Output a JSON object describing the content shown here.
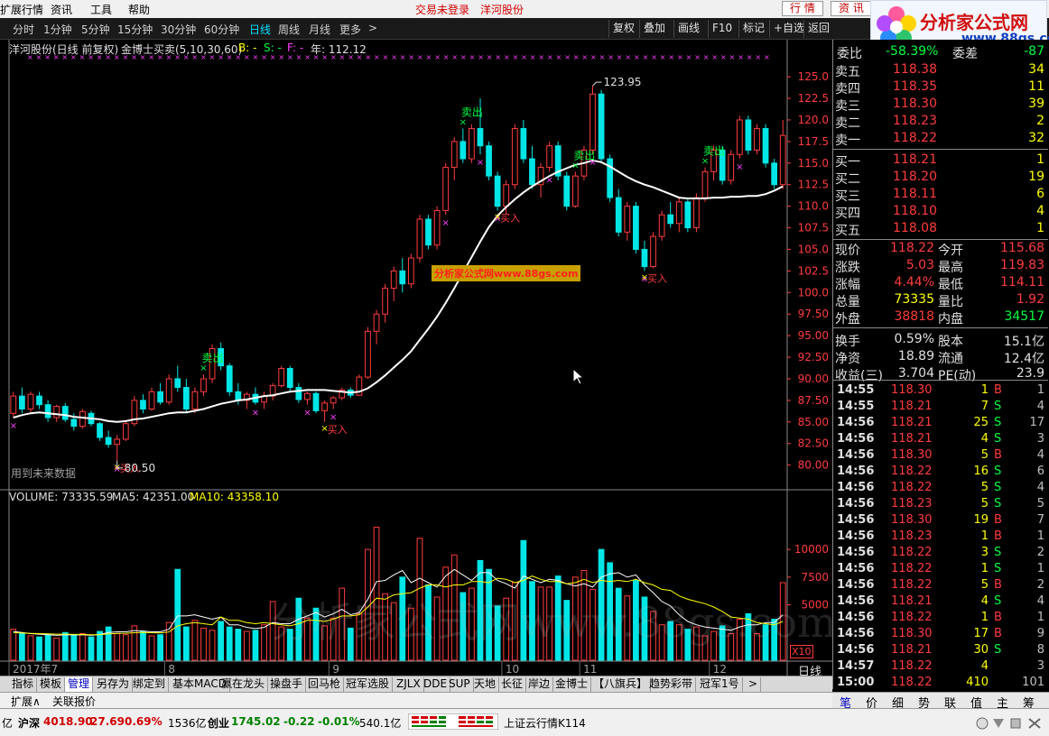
{
  "menubar": {
    "items": [
      "扩展行情",
      "资讯",
      "工具",
      "帮助"
    ],
    "center_status": "交易未登录",
    "center_stock": "洋河股份",
    "btn_quote": "行 情",
    "btn_info": "资 讯"
  },
  "logo": {
    "title": "分析家公式网",
    "url": "www.88gs.com"
  },
  "toolbar": {
    "periods": [
      "分时",
      "1分钟",
      "5分钟",
      "15分钟",
      "30分钟",
      "60分钟",
      "日线",
      "周线",
      "月线",
      "更多"
    ],
    "active_period": "日线",
    "more_arrow": ">",
    "right_buttons": [
      "复权",
      "叠加",
      "画线",
      "F10",
      "标记",
      "+自选",
      "返回"
    ]
  },
  "chart_header": {
    "stock": "洋河股份(日线 前复权)",
    "indicator": "金博士买卖(5,10,30,60)",
    "b_label": "B: -",
    "s_label": "S: -",
    "f_label": "F: -",
    "year_label": "年: 112.12"
  },
  "price_axis": {
    "ticks": [
      "125.0",
      "122.5",
      "120.0",
      "117.5",
      "115.0",
      "112.5",
      "110.0",
      "107.5",
      "105.0",
      "102.5",
      "100.0",
      "97.50",
      "95.00",
      "92.50",
      "90.00",
      "87.50",
      "85.00",
      "82.50",
      "80.00"
    ]
  },
  "annotations": {
    "high_label": "123.95",
    "low_label": "80.50",
    "sell_labels": [
      "卖出",
      "卖出",
      "卖出",
      "卖出"
    ],
    "buy_labels": [
      "买入",
      "买入",
      "买入",
      "买入"
    ],
    "future_note": "用到未来数据",
    "watermark_box": "分析家公式网www.88gs.com",
    "watermark_big": "分析家公式网www.88gs.com"
  },
  "volume_panel": {
    "volume_label": "VOLUME: 73335.59",
    "ma5_label": "MA5: 42351.00",
    "ma10_label": "MA10: 43358.10",
    "ticks": [
      "10000",
      "7500",
      "5000"
    ],
    "unit": "X10"
  },
  "date_axis": {
    "labels": [
      "2017年7",
      "8",
      "9",
      "10",
      "11",
      "12"
    ],
    "period": "日线",
    "controls": [
      "+",
      "-",
      "0"
    ]
  },
  "colors": {
    "up": "#ff3c3c",
    "down": "#00e6e6",
    "ma_line": "#ffffff",
    "sell": "#00ff40",
    "buy": "#ffff00",
    "marker_magenta": "#ff40ff",
    "accent_yellow": "#ffff00"
  },
  "chart_data": {
    "type": "candlestick",
    "title": "洋河股份(日线 前复权)",
    "xlabel": "",
    "ylabel": "",
    "ylim": [
      78.5,
      127
    ],
    "candles": [
      [
        86,
        88.5,
        85.5,
        88
      ],
      [
        88,
        89,
        86,
        86.5
      ],
      [
        86.5,
        88.5,
        86,
        88.2
      ],
      [
        88,
        88.5,
        86.5,
        87
      ],
      [
        87,
        87.5,
        85,
        85.5
      ],
      [
        85.5,
        87,
        85,
        86.8
      ],
      [
        86.8,
        87.2,
        85,
        85.3
      ],
      [
        85.3,
        86,
        84,
        84.5
      ],
      [
        84.5,
        86.5,
        84.2,
        86.2
      ],
      [
        86,
        86.3,
        84.5,
        84.8
      ],
      [
        84.8,
        85,
        82.8,
        83.2
      ],
      [
        83.2,
        84,
        82,
        82.4
      ],
      [
        82.4,
        83.5,
        80.5,
        83
      ],
      [
        83,
        85,
        82.8,
        84.8
      ],
      [
        84.8,
        88,
        84.5,
        87.5
      ],
      [
        87.5,
        88.2,
        86,
        86.5
      ],
      [
        86.5,
        89,
        86.3,
        88.5
      ],
      [
        88.5,
        89.5,
        87,
        87.3
      ],
      [
        87.3,
        90.5,
        87,
        90
      ],
      [
        90,
        91.5,
        88.5,
        89
      ],
      [
        89,
        90,
        86,
        86.5
      ],
      [
        86.5,
        89,
        86,
        88.5
      ],
      [
        88.5,
        90.5,
        88,
        90
      ],
      [
        90,
        94,
        89.5,
        93.5
      ],
      [
        93.5,
        94.2,
        91,
        91.5
      ],
      [
        91.5,
        91.8,
        88,
        88.5
      ],
      [
        88.5,
        89.5,
        87,
        87.5
      ],
      [
        87.5,
        88.5,
        86.5,
        88.2
      ],
      [
        88.2,
        89,
        87,
        87.3
      ],
      [
        87.3,
        88.5,
        86.5,
        88
      ],
      [
        88,
        89.5,
        87.5,
        89.2
      ],
      [
        89.2,
        91.5,
        89,
        91.2
      ],
      [
        91.2,
        91.5,
        88.5,
        89
      ],
      [
        89,
        89.5,
        87.2,
        87.6
      ],
      [
        87.6,
        88.5,
        87,
        88.3
      ],
      [
        88.3,
        88.5,
        86,
        86.3
      ],
      [
        86.3,
        87.5,
        85,
        87.2
      ],
      [
        87.2,
        88,
        86.5,
        87.8
      ],
      [
        87.8,
        89,
        87.5,
        88.7
      ],
      [
        88.7,
        89,
        87.8,
        88.1
      ],
      [
        88.1,
        90.5,
        88,
        90.2
      ],
      [
        90.2,
        96,
        90,
        95.5
      ],
      [
        95.5,
        98,
        94,
        97.5
      ],
      [
        97.5,
        101,
        96.5,
        100.5
      ],
      [
        100.5,
        103,
        99,
        102.5
      ],
      [
        102.5,
        104,
        100,
        101
      ],
      [
        101,
        104.5,
        100.5,
        104
      ],
      [
        104,
        109,
        103.5,
        108.5
      ],
      [
        108.5,
        109,
        105,
        105.5
      ],
      [
        105.5,
        110,
        105,
        109.5
      ],
      [
        109.5,
        115,
        109,
        114.5
      ],
      [
        114.5,
        118,
        113,
        117.5
      ],
      [
        117.5,
        119,
        115,
        115.5
      ],
      [
        115.5,
        119.5,
        115,
        119
      ],
      [
        119,
        122.5,
        116,
        117
      ],
      [
        117,
        117.5,
        113,
        113.5
      ],
      [
        113.5,
        114,
        109.5,
        110
      ],
      [
        110,
        113,
        109,
        112.5
      ],
      [
        112.5,
        119.5,
        112,
        119
      ],
      [
        119,
        120,
        115,
        115.5
      ],
      [
        115.5,
        117,
        112,
        112.5
      ],
      [
        112.5,
        115,
        111,
        114.5
      ],
      [
        114.5,
        117.5,
        114,
        117
      ],
      [
        117,
        117.5,
        113,
        113.5
      ],
      [
        113.5,
        114,
        109.5,
        110
      ],
      [
        110,
        114,
        109.8,
        113.5
      ],
      [
        113.5,
        117,
        113,
        116.5
      ],
      [
        116.5,
        123.95,
        116,
        123
      ],
      [
        123,
        123.5,
        115,
        115.5
      ],
      [
        115.5,
        116,
        110.5,
        111
      ],
      [
        111,
        112,
        106.5,
        107
      ],
      [
        107,
        110.5,
        106,
        110
      ],
      [
        110,
        110.5,
        104.5,
        105
      ],
      [
        105,
        106,
        102.5,
        103
      ],
      [
        103,
        107,
        102.8,
        106.5
      ],
      [
        106.5,
        109.5,
        106,
        109
      ],
      [
        109,
        110.5,
        107.5,
        108
      ],
      [
        108,
        111,
        107,
        110.5
      ],
      [
        110.5,
        111,
        107,
        107.5
      ],
      [
        107.5,
        111.5,
        107,
        111
      ],
      [
        111,
        114.5,
        110.5,
        114
      ],
      [
        114,
        117,
        113,
        116.5
      ],
      [
        116.5,
        117,
        112.5,
        113
      ],
      [
        113,
        116.5,
        112.5,
        116
      ],
      [
        116,
        120.5,
        115.5,
        120
      ],
      [
        120,
        120.5,
        116,
        116.5
      ],
      [
        116.5,
        119.5,
        116,
        119
      ],
      [
        119,
        119.5,
        114.5,
        115
      ],
      [
        115,
        115.5,
        112,
        112.5
      ],
      [
        112.5,
        120,
        112,
        118.2
      ]
    ],
    "ma_line": [
      85.5,
      85.8,
      86,
      86.1,
      86,
      85.9,
      85.8,
      85.6,
      85.5,
      85.4,
      85.3,
      85.1,
      85,
      85.1,
      85.3,
      85.4,
      85.6,
      85.8,
      86,
      86.1,
      86.1,
      86.3,
      86.5,
      86.8,
      87.1,
      87.3,
      87.5,
      87.6,
      87.8,
      88,
      88.1,
      88.3,
      88.5,
      88.6,
      88.7,
      88.7,
      88.7,
      88.6,
      88.5,
      88.4,
      88.5,
      88.9,
      89.6,
      90.4,
      91.3,
      92.2,
      93.2,
      94.5,
      95.8,
      97.2,
      98.8,
      100.5,
      102.3,
      104.1,
      105.9,
      107.6,
      108.9,
      109.9,
      110.8,
      111.6,
      112.3,
      112.9,
      113.5,
      114,
      114.4,
      114.8,
      115,
      115.3,
      115.1,
      114.6,
      114,
      113.4,
      112.9,
      112.5,
      112.2,
      111.8,
      111.4,
      111,
      110.9,
      110.9,
      110.9,
      111,
      111,
      111.1,
      111.1,
      111.2,
      111.2,
      111.4,
      111.8,
      112.3
    ],
    "volume": [
      2800,
      2400,
      2200,
      2100,
      2300,
      2000,
      2500,
      2200,
      2400,
      2100,
      2600,
      3000,
      2400,
      2300,
      3100,
      2600,
      2200,
      2300,
      3400,
      8200,
      3000,
      3600,
      2900,
      2700,
      3500,
      3000,
      2800,
      2600,
      2700,
      3200,
      5300,
      3000,
      2800,
      5600,
      3800,
      4700,
      3100,
      3800,
      6500,
      2900,
      4200,
      10000,
      12000,
      6000,
      5200,
      7500,
      4700,
      11000,
      6800,
      5700,
      8400,
      9500,
      6100,
      6500,
      9000,
      8200,
      4900,
      5600,
      7000,
      10800,
      7100,
      6600,
      6600,
      7600,
      5400,
      7500,
      8100,
      6400,
      10000,
      8800,
      6500,
      5800,
      7200,
      5700,
      4400,
      3200,
      3500,
      3200,
      2800,
      3000,
      2200,
      2600,
      3100,
      2400,
      3700,
      4200,
      2400,
      3200,
      3700,
      7000
    ],
    "ma5_vol": [
      2600,
      2500,
      2400,
      2350,
      2300,
      2250,
      2300,
      2280,
      2300,
      2250,
      2320,
      2500,
      2560,
      2560,
      2680,
      2640,
      2560,
      2560,
      2800,
      4000,
      4000,
      4100,
      3900,
      3700,
      3900,
      3200,
      3200,
      2960,
      2860,
      2960,
      3400,
      3300,
      3300,
      3700,
      4000,
      4300,
      3900,
      4200,
      4600,
      4100,
      4300,
      5500,
      7100,
      7200,
      7700,
      8100,
      7000,
      7400,
      7000,
      6600,
      7600,
      8200,
      7700,
      7200,
      7900,
      7900,
      7200,
      6900,
      6500,
      7600,
      7300,
      7000,
      7300,
      7200,
      6900,
      6700,
      6900,
      6600,
      7500,
      7800,
      7900,
      7500,
      7700,
      6800,
      6100,
      5300,
      4900,
      4100,
      3500,
      3200,
      3000,
      2900,
      2800,
      2700,
      3000,
      3200,
      3200,
      3400,
      3400,
      4100
    ],
    "ma10_vol": [
      2500,
      2450,
      2420,
      2400,
      2380,
      2350,
      2350,
      2330,
      2330,
      2300,
      2310,
      2380,
      2420,
      2430,
      2480,
      2500,
      2480,
      2470,
      2550,
      3100,
      3300,
      3400,
      3300,
      3200,
      3900,
      3600,
      3600,
      3400,
      3300,
      3400,
      3300,
      3200,
      3100,
      3300,
      3600,
      3600,
      3500,
      3700,
      4000,
      4000,
      4100,
      4800,
      5600,
      5500,
      5900,
      6000,
      6100,
      6500,
      6800,
      6800,
      6600,
      6800,
      6800,
      7100,
      7100,
      7000,
      7400,
      7300,
      7000,
      7200,
      7600,
      7300,
      7100,
      7100,
      6900,
      7000,
      7300,
      7000,
      7200,
      7100,
      7200,
      7100,
      7300,
      7000,
      6800,
      6400,
      6300,
      5800,
      5500,
      5300,
      5100,
      4800,
      4400,
      3900,
      3800,
      3700,
      3400,
      3300,
      3200,
      3500
    ],
    "sell_signals": [
      22,
      52,
      65,
      80
    ],
    "buy_signals": [
      12,
      36,
      56,
      73
    ],
    "magenta_marks": [
      0,
      12,
      28,
      34,
      37,
      50,
      54,
      56,
      62,
      67,
      73,
      84
    ],
    "high": 123.95,
    "low": 80.5
  },
  "quote": {
    "header": {
      "label": "委比",
      "value": "-58.39%",
      "label2": "委差",
      "value2": "-87"
    },
    "asks": [
      {
        "label": "卖五",
        "price": "118.38",
        "vol": "34"
      },
      {
        "label": "卖四",
        "price": "118.35",
        "vol": "11"
      },
      {
        "label": "卖三",
        "price": "118.30",
        "vol": "39"
      },
      {
        "label": "卖二",
        "price": "118.23",
        "vol": "2"
      },
      {
        "label": "卖一",
        "price": "118.22",
        "vol": "32"
      }
    ],
    "bids": [
      {
        "label": "买一",
        "price": "118.21",
        "vol": "1"
      },
      {
        "label": "买二",
        "price": "118.20",
        "vol": "19"
      },
      {
        "label": "买三",
        "price": "118.11",
        "vol": "6"
      },
      {
        "label": "买四",
        "price": "118.10",
        "vol": "4"
      },
      {
        "label": "买五",
        "price": "118.08",
        "vol": "1"
      }
    ],
    "stats": [
      {
        "l1": "现价",
        "v1": "118.22",
        "l2": "今开",
        "v2": "115.68",
        "c1": "#ff3c3c",
        "c2": "#ff3c3c"
      },
      {
        "l1": "涨跌",
        "v1": "5.03",
        "l2": "最高",
        "v2": "119.83",
        "c1": "#ff3c3c",
        "c2": "#ff3c3c"
      },
      {
        "l1": "涨幅",
        "v1": "4.44%",
        "l2": "最低",
        "v2": "114.11",
        "c1": "#ff3c3c",
        "c2": "#ff3c3c"
      },
      {
        "l1": "总量",
        "v1": "73335",
        "l2": "量比",
        "v2": "1.92",
        "c1": "#ffff00",
        "c2": "#ff3c3c"
      },
      {
        "l1": "外盘",
        "v1": "38818",
        "l2": "内盘",
        "v2": "34517",
        "c1": "#ff3c3c",
        "c2": "#00ff40"
      },
      {
        "l1": "换手",
        "v1": "0.59%",
        "l2": "股本",
        "v2": "15.1亿",
        "c1": "#e0e0e0",
        "c2": "#e0e0e0"
      },
      {
        "l1": "净资",
        "v1": "18.89",
        "l2": "流通",
        "v2": "12.4亿",
        "c1": "#e0e0e0",
        "c2": "#e0e0e0"
      },
      {
        "l1": "收益(三)",
        "v1": "3.704",
        "l2": "PE(动)",
        "v2": "23.9",
        "c1": "#e0e0e0",
        "c2": "#e0e0e0"
      }
    ],
    "ticks": [
      {
        "time": "14:55",
        "price": "118.30",
        "vol": "1",
        "bs": "B",
        "n": "1"
      },
      {
        "time": "14:55",
        "price": "118.21",
        "vol": "7",
        "bs": "S",
        "n": "4"
      },
      {
        "time": "14:56",
        "price": "118.21",
        "vol": "25",
        "bs": "S",
        "n": "17"
      },
      {
        "time": "14:56",
        "price": "118.21",
        "vol": "4",
        "bs": "S",
        "n": "3"
      },
      {
        "time": "14:56",
        "price": "118.30",
        "vol": "5",
        "bs": "B",
        "n": "4"
      },
      {
        "time": "14:56",
        "price": "118.22",
        "vol": "16",
        "bs": "S",
        "n": "6"
      },
      {
        "time": "14:56",
        "price": "118.22",
        "vol": "5",
        "bs": "S",
        "n": "4"
      },
      {
        "time": "14:56",
        "price": "118.23",
        "vol": "5",
        "bs": "S",
        "n": "5"
      },
      {
        "time": "14:56",
        "price": "118.30",
        "vol": "19",
        "bs": "B",
        "n": "7"
      },
      {
        "time": "14:56",
        "price": "118.23",
        "vol": "1",
        "bs": "B",
        "n": "1"
      },
      {
        "time": "14:56",
        "price": "118.22",
        "vol": "3",
        "bs": "S",
        "n": "2"
      },
      {
        "time": "14:56",
        "price": "118.22",
        "vol": "1",
        "bs": "S",
        "n": "1"
      },
      {
        "time": "14:56",
        "price": "118.22",
        "vol": "5",
        "bs": "B",
        "n": "2"
      },
      {
        "time": "14:56",
        "price": "118.21",
        "vol": "4",
        "bs": "S",
        "n": "4"
      },
      {
        "time": "14:56",
        "price": "118.22",
        "vol": "1",
        "bs": "B",
        "n": "1"
      },
      {
        "time": "14:56",
        "price": "118.30",
        "vol": "17",
        "bs": "B",
        "n": "9"
      },
      {
        "time": "14:56",
        "price": "118.21",
        "vol": "30",
        "bs": "S",
        "n": "8"
      },
      {
        "time": "14:57",
        "price": "118.22",
        "vol": "4",
        "bs": "",
        "n": "3"
      },
      {
        "time": "15:00",
        "price": "118.22",
        "vol": "410",
        "bs": "",
        "n": "101"
      }
    ]
  },
  "tabs": {
    "row1": [
      "指标",
      "模板",
      "管理",
      "另存为",
      "绑定到",
      "基本MACD",
      "赢在龙头",
      "操盘手",
      "回马枪",
      "冠军选股",
      "ZJLX",
      "DDE",
      "SUP",
      "天地",
      "长征",
      "岸边",
      "金博士",
      "【八旗兵】",
      "趋势彩带",
      "冠军1号",
      ">"
    ],
    "selected": "管理",
    "row2": [
      "扩展∧",
      "关联报价"
    ],
    "right": [
      "笔",
      "价",
      "细",
      "势",
      "联",
      "值",
      "主",
      "筹"
    ],
    "right_selected": "笔"
  },
  "statusbar": {
    "yi": "亿",
    "sz_label": "沪深",
    "sz_value": "4018.90",
    "sz_change": "27.69",
    "sz_pct": "0.69%",
    "sz_amount": "1536亿",
    "cy_label": "创业",
    "cy_value": "1745.02",
    "cy_change": "-0.22",
    "cy_pct": "-0.01%",
    "cy_amount": "540.1亿",
    "cloud": "上证云行情K114"
  }
}
